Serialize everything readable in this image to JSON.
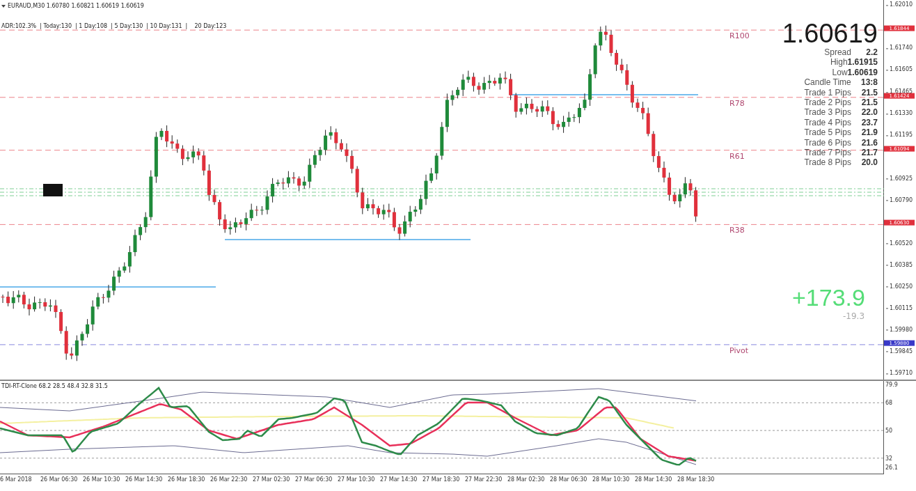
{
  "header": {
    "symbol_line": "EURAUD,M30  1.60780 1.60821 1.60619 1.60619",
    "adr_line": "ADR:102.3%  | Today:130  | 1 Day:108  | 5 Day:130  | 10 Day:131  |    20 Day:123"
  },
  "levels": [
    {
      "label": "R100",
      "price": "1.61844",
      "color": "#e0303c"
    },
    {
      "label": "R78",
      "price": "1.61424",
      "color": "#e0303c"
    },
    {
      "label": "R61",
      "price": "1.61094",
      "color": "#e0303c"
    },
    {
      "label": "R38",
      "price": "1.60630",
      "color": "#e0303c"
    },
    {
      "label": "Pivot",
      "price": "1.59880",
      "color": "#3838c8"
    }
  ],
  "price_axis": {
    "ticks": [
      "1.62010",
      "1.61740",
      "1.61605",
      "1.61465",
      "1.61330",
      "1.61195",
      "1.60925",
      "1.60790",
      "1.60520",
      "1.60385",
      "1.60250",
      "1.60115",
      "1.59980",
      "1.59845",
      "1.59710"
    ]
  },
  "info_panel": {
    "price": "1.60619",
    "rows": [
      {
        "kind": "spaced",
        "label": "Spread",
        "value": "2.2"
      },
      {
        "kind": "joined",
        "label": "High",
        "value": "1.61915"
      },
      {
        "kind": "joined",
        "label": "Low",
        "value": "1.60619"
      },
      {
        "kind": "spaced",
        "label": "Candle Time",
        "value": "13:8"
      },
      {
        "kind": "spaced",
        "label": "Trade 1 Pips",
        "value": "21.5"
      },
      {
        "kind": "spaced",
        "label": "Trade 2 Pips",
        "value": "21.5"
      },
      {
        "kind": "spaced",
        "label": "Trade 3 Pips",
        "value": "22.0"
      },
      {
        "kind": "spaced",
        "label": "Trade 4 Pips",
        "value": "23.7"
      },
      {
        "kind": "spaced",
        "label": "Trade 5 Pips",
        "value": "21.9"
      },
      {
        "kind": "spaced",
        "label": "Trade 6 Pips",
        "value": "21.6"
      },
      {
        "kind": "spaced",
        "label": "Trade 7 Pips",
        "value": "21.7"
      },
      {
        "kind": "spaced",
        "label": "Trade 8 Pips",
        "value": "20.0"
      }
    ]
  },
  "profit": {
    "total": "+173.9",
    "current": "-19.3"
  },
  "indicator": {
    "title": "TDI-RT-Clone 68.2 28.5 48.4 32.8 31.5",
    "axis": [
      "79.9",
      "68",
      "50",
      "32",
      "26.1"
    ]
  },
  "time_axis": {
    "labels": [
      "6 Mar 2018",
      "26 Mar 06:30",
      "26 Mar 10:30",
      "26 Mar 14:30",
      "26 Mar 18:30",
      "26 Mar 22:30",
      "27 Mar 02:30",
      "27 Mar 06:30",
      "27 Mar 10:30",
      "27 Mar 14:30",
      "27 Mar 18:30",
      "27 Mar 22:30",
      "28 Mar 02:30",
      "28 Mar 06:30",
      "28 Mar 10:30",
      "28 Mar 14:30",
      "28 Mar 18:30"
    ]
  }
}
